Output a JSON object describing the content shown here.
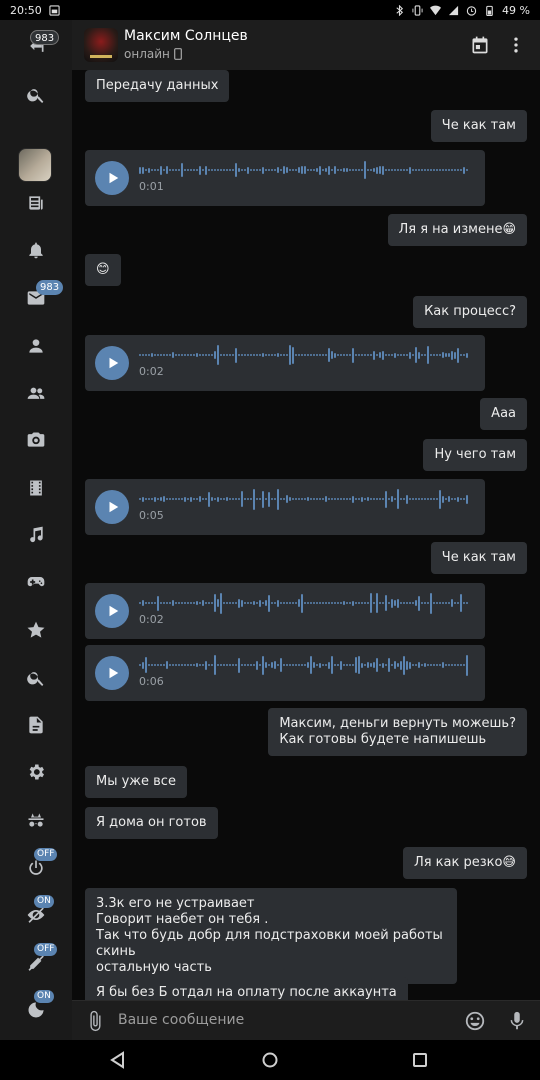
{
  "status_bar": {
    "time": "20:50",
    "battery": "49 %"
  },
  "rail": {
    "back_badge": "983",
    "messages_badge": "983",
    "toggles": [
      "OFF",
      "ON",
      "OFF",
      "ON"
    ]
  },
  "header": {
    "contact_name": "Максим Солнцев",
    "contact_status": "онлайн"
  },
  "messages": [
    {
      "dir": "in",
      "text": "Передачу данных"
    },
    {
      "dir": "out",
      "text": "Че как там"
    },
    {
      "dir": "in",
      "type": "voice",
      "duration": "0:01"
    },
    {
      "dir": "out",
      "text": "Ля я на измене😁"
    },
    {
      "dir": "in",
      "text": "😊"
    },
    {
      "dir": "out",
      "text": "Как процесс?"
    },
    {
      "dir": "in",
      "type": "voice",
      "duration": "0:02"
    },
    {
      "dir": "out",
      "text": "Ааа"
    },
    {
      "dir": "out",
      "text": "Ну чего там"
    },
    {
      "dir": "in",
      "type": "voice",
      "duration": "0:05"
    },
    {
      "dir": "out",
      "text": "Че как там"
    },
    {
      "dir": "in",
      "type": "voice",
      "duration": "0:02"
    },
    {
      "dir": "in",
      "type": "voice",
      "duration": "0:06"
    },
    {
      "dir": "out",
      "lines": [
        "Максим, деньги вернуть можешь?",
        "Как готовы будете напишешь"
      ]
    },
    {
      "dir": "in",
      "text": "Мы уже все"
    },
    {
      "dir": "in",
      "text": "Я дома он готов"
    },
    {
      "dir": "out",
      "text": "Ля как резко😅"
    },
    {
      "dir": "in",
      "lines": [
        "3.3к его не устраивает",
        "Говорит наебет он тебя .",
        "Так что будь добр для подстраховки моей работы скинь",
        "остальную часть"
      ]
    },
    {
      "dir": "in",
      "text": "Я бы без Б отдал на оплату после аккаунта"
    }
  ],
  "composer": {
    "placeholder": "Ваше сообщение"
  },
  "colors": {
    "accent": "#5b84b1",
    "bubble": "#2c2f33",
    "background": "#0a0a0a"
  }
}
